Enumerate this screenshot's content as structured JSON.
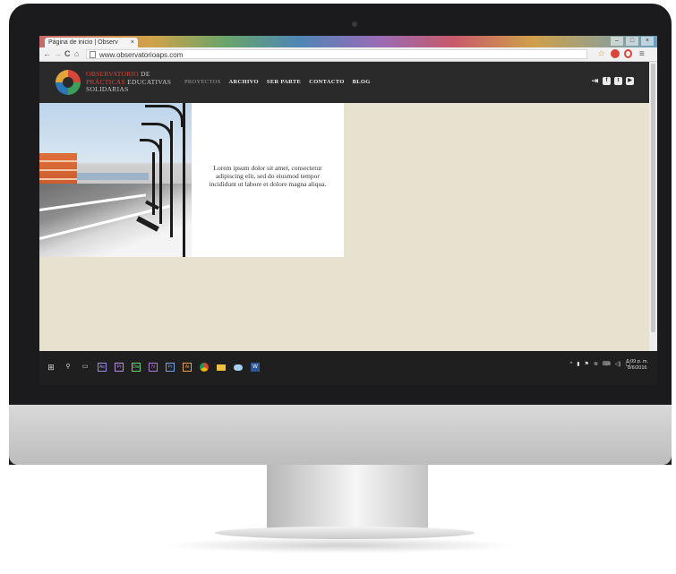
{
  "browser": {
    "tab_title": "Página de inicio | Observ",
    "tab_close": "×",
    "url": "www.observatorioaps.com",
    "back": "←",
    "forward": "→",
    "reload": "C",
    "home": "⌂",
    "star": "☆",
    "menu": "≡"
  },
  "site": {
    "logo": {
      "line1_a": "OBSERVATORIO",
      "line1_b": " DE",
      "line2_a": "PRÁCTICAS ",
      "line2_b": "EDUCATIVAS",
      "line3": "SOLIDARIAS"
    },
    "nav": [
      "PROYECTOS",
      "ARCHIVO",
      "SER PARTE",
      "CONTACTO",
      "BLOG"
    ],
    "social_icons": [
      "login-icon",
      "facebook-icon",
      "twitter-icon",
      "youtube-icon"
    ],
    "hero_text": "Lorem ipsum dolor sit amet, consectetur adipiscing elit, sed do eiusmod tempor incididunt ut labore et dolore magna aliqua."
  },
  "taskbar": {
    "apps": [
      "Ae",
      "Pr",
      "Dw",
      "N",
      "Pr",
      "Ai"
    ],
    "time": "6:09 p. m.",
    "date": "8/6/2016"
  },
  "colors": {
    "header_bg": "#2a2a2a",
    "page_bg": "#e7e2d0",
    "logo_red": "#d9453a"
  }
}
